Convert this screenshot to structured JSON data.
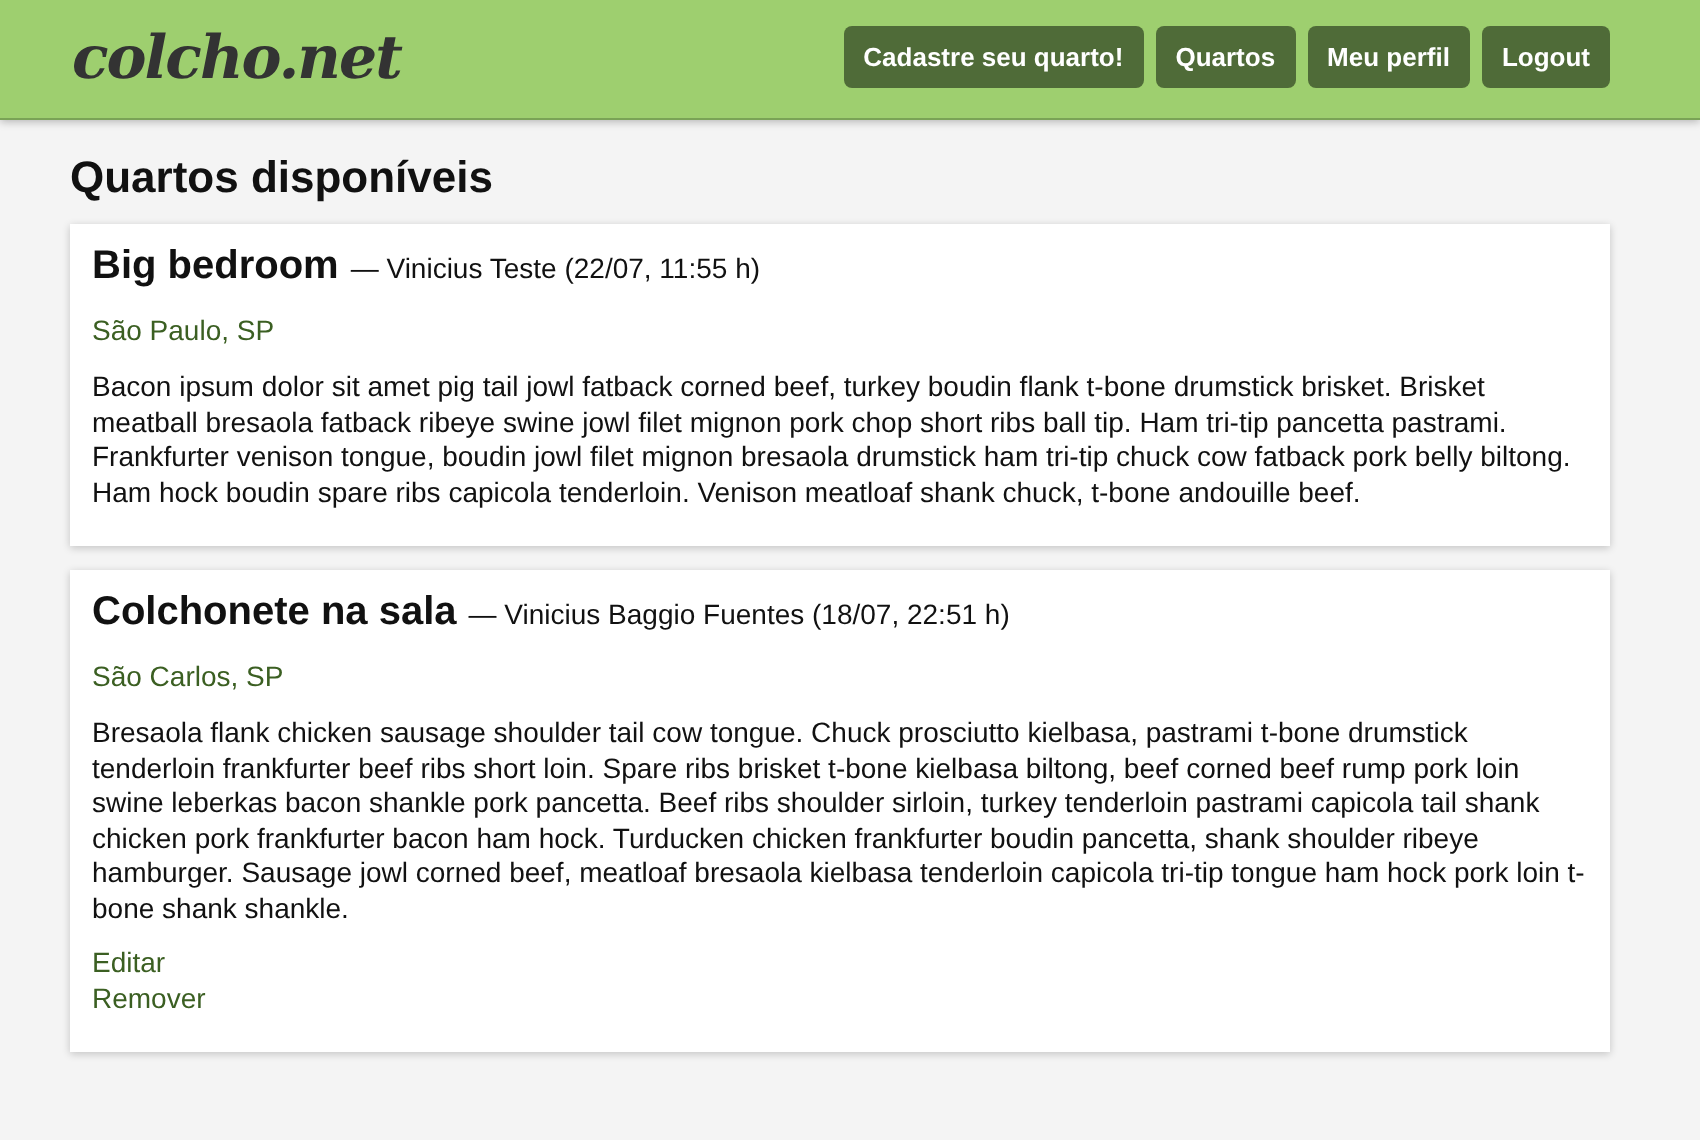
{
  "header": {
    "logo": "colcho.net",
    "nav": [
      {
        "label": "Cadastre seu quarto!"
      },
      {
        "label": "Quartos"
      },
      {
        "label": "Meu perfil"
      },
      {
        "label": "Logout"
      }
    ]
  },
  "page_title": "Quartos disponíveis",
  "rooms": [
    {
      "title": "Big bedroom",
      "byline": "— Vinicius Teste (22/07, 11:55 h)",
      "location": "São Paulo, SP",
      "description": "Bacon ipsum dolor sit amet pig tail jowl fatback corned beef, turkey boudin flank t-bone drumstick brisket. Brisket meatball bresaola fatback ribeye swine jowl filet mignon pork chop short ribs ball tip. Ham tri-tip pancetta pastrami. Frankfurter venison tongue, boudin jowl filet mignon bresaola drumstick ham tri-tip chuck cow fatback pork belly biltong. Ham hock boudin spare ribs capicola tenderloin. Venison meatloaf shank chuck, t-bone andouille beef."
    },
    {
      "title": "Colchonete na sala",
      "byline": "— Vinicius Baggio Fuentes (18/07, 22:51 h)",
      "location": "São Carlos, SP",
      "description": "Bresaola flank chicken sausage shoulder tail cow tongue. Chuck prosciutto kielbasa, pastrami t-bone drumstick tenderloin frankfurter beef ribs short loin. Spare ribs brisket t-bone kielbasa biltong, beef corned beef rump pork loin swine leberkas bacon shankle pork pancetta. Beef ribs shoulder sirloin, turkey tenderloin pastrami capicola tail shank chicken pork frankfurter bacon ham hock. Turducken chicken frankfurter boudin pancetta, shank shoulder ribeye hamburger. Sausage jowl corned beef, meatloaf bresaola kielbasa tenderloin capicola tri-tip tongue ham hock pork loin t-bone shank shankle.",
      "actions": [
        "Editar",
        "Remover"
      ]
    }
  ]
}
